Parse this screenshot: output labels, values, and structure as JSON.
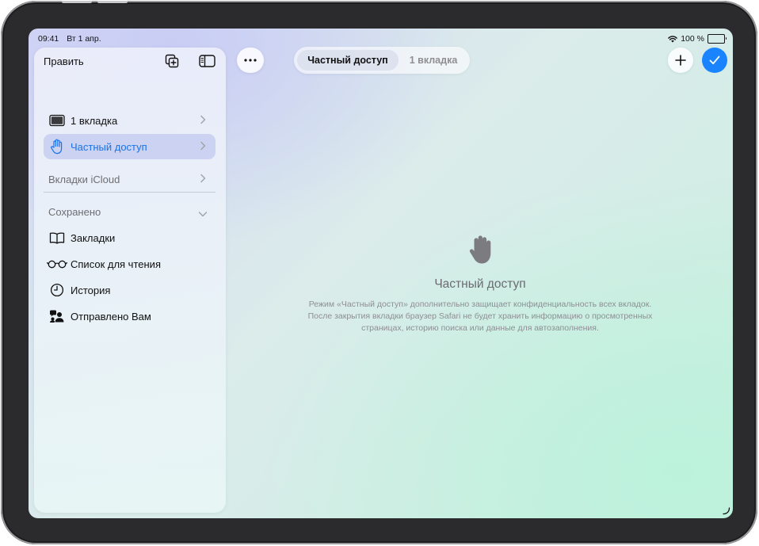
{
  "status_bar": {
    "time": "09:41",
    "date": "Вт 1 апр.",
    "battery_percent": "100 %"
  },
  "sidebar": {
    "edit_label": "Править",
    "tab_groups": [
      {
        "label": "1 вкладка",
        "icon": "tablet-icon"
      },
      {
        "label": "Частный доступ",
        "icon": "hand-icon",
        "active": true
      }
    ],
    "icloud_tabs_label": "Вкладки iCloud",
    "saved_header": "Сохранено",
    "saved_items": [
      {
        "label": "Закладки",
        "icon": "book-icon"
      },
      {
        "label": "Список для чтения",
        "icon": "glasses-icon"
      },
      {
        "label": "История",
        "icon": "clock-icon"
      },
      {
        "label": "Отправлено Вам",
        "icon": "shared-with-you-icon"
      }
    ]
  },
  "toolbar": {
    "segments": [
      "Частный доступ",
      "1 вкладка"
    ],
    "selected_segment": "Частный доступ"
  },
  "private_mode": {
    "title": "Частный доступ",
    "description": "Режим «Частный доступ» дополнительно защищает конфиденциальность всех вкладок. После закрытия вкладки браузер Safari не будет хранить информацию о просмотренных страницах, историю поиска или данные для автозаполнения."
  },
  "colors": {
    "accent": "#1a84ff",
    "active_text": "#1a73e8"
  }
}
